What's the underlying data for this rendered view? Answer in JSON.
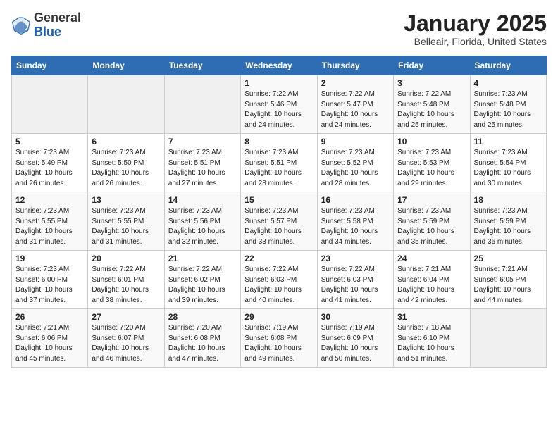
{
  "header": {
    "logo_general": "General",
    "logo_blue": "Blue",
    "title": "January 2025",
    "subtitle": "Belleair, Florida, United States"
  },
  "days_of_week": [
    "Sunday",
    "Monday",
    "Tuesday",
    "Wednesday",
    "Thursday",
    "Friday",
    "Saturday"
  ],
  "weeks": [
    [
      {
        "day": "",
        "info": ""
      },
      {
        "day": "",
        "info": ""
      },
      {
        "day": "",
        "info": ""
      },
      {
        "day": "1",
        "info": "Sunrise: 7:22 AM\nSunset: 5:46 PM\nDaylight: 10 hours\nand 24 minutes."
      },
      {
        "day": "2",
        "info": "Sunrise: 7:22 AM\nSunset: 5:47 PM\nDaylight: 10 hours\nand 24 minutes."
      },
      {
        "day": "3",
        "info": "Sunrise: 7:22 AM\nSunset: 5:48 PM\nDaylight: 10 hours\nand 25 minutes."
      },
      {
        "day": "4",
        "info": "Sunrise: 7:23 AM\nSunset: 5:48 PM\nDaylight: 10 hours\nand 25 minutes."
      }
    ],
    [
      {
        "day": "5",
        "info": "Sunrise: 7:23 AM\nSunset: 5:49 PM\nDaylight: 10 hours\nand 26 minutes."
      },
      {
        "day": "6",
        "info": "Sunrise: 7:23 AM\nSunset: 5:50 PM\nDaylight: 10 hours\nand 26 minutes."
      },
      {
        "day": "7",
        "info": "Sunrise: 7:23 AM\nSunset: 5:51 PM\nDaylight: 10 hours\nand 27 minutes."
      },
      {
        "day": "8",
        "info": "Sunrise: 7:23 AM\nSunset: 5:51 PM\nDaylight: 10 hours\nand 28 minutes."
      },
      {
        "day": "9",
        "info": "Sunrise: 7:23 AM\nSunset: 5:52 PM\nDaylight: 10 hours\nand 28 minutes."
      },
      {
        "day": "10",
        "info": "Sunrise: 7:23 AM\nSunset: 5:53 PM\nDaylight: 10 hours\nand 29 minutes."
      },
      {
        "day": "11",
        "info": "Sunrise: 7:23 AM\nSunset: 5:54 PM\nDaylight: 10 hours\nand 30 minutes."
      }
    ],
    [
      {
        "day": "12",
        "info": "Sunrise: 7:23 AM\nSunset: 5:55 PM\nDaylight: 10 hours\nand 31 minutes."
      },
      {
        "day": "13",
        "info": "Sunrise: 7:23 AM\nSunset: 5:55 PM\nDaylight: 10 hours\nand 31 minutes."
      },
      {
        "day": "14",
        "info": "Sunrise: 7:23 AM\nSunset: 5:56 PM\nDaylight: 10 hours\nand 32 minutes."
      },
      {
        "day": "15",
        "info": "Sunrise: 7:23 AM\nSunset: 5:57 PM\nDaylight: 10 hours\nand 33 minutes."
      },
      {
        "day": "16",
        "info": "Sunrise: 7:23 AM\nSunset: 5:58 PM\nDaylight: 10 hours\nand 34 minutes."
      },
      {
        "day": "17",
        "info": "Sunrise: 7:23 AM\nSunset: 5:59 PM\nDaylight: 10 hours\nand 35 minutes."
      },
      {
        "day": "18",
        "info": "Sunrise: 7:23 AM\nSunset: 5:59 PM\nDaylight: 10 hours\nand 36 minutes."
      }
    ],
    [
      {
        "day": "19",
        "info": "Sunrise: 7:23 AM\nSunset: 6:00 PM\nDaylight: 10 hours\nand 37 minutes."
      },
      {
        "day": "20",
        "info": "Sunrise: 7:22 AM\nSunset: 6:01 PM\nDaylight: 10 hours\nand 38 minutes."
      },
      {
        "day": "21",
        "info": "Sunrise: 7:22 AM\nSunset: 6:02 PM\nDaylight: 10 hours\nand 39 minutes."
      },
      {
        "day": "22",
        "info": "Sunrise: 7:22 AM\nSunset: 6:03 PM\nDaylight: 10 hours\nand 40 minutes."
      },
      {
        "day": "23",
        "info": "Sunrise: 7:22 AM\nSunset: 6:03 PM\nDaylight: 10 hours\nand 41 minutes."
      },
      {
        "day": "24",
        "info": "Sunrise: 7:21 AM\nSunset: 6:04 PM\nDaylight: 10 hours\nand 42 minutes."
      },
      {
        "day": "25",
        "info": "Sunrise: 7:21 AM\nSunset: 6:05 PM\nDaylight: 10 hours\nand 44 minutes."
      }
    ],
    [
      {
        "day": "26",
        "info": "Sunrise: 7:21 AM\nSunset: 6:06 PM\nDaylight: 10 hours\nand 45 minutes."
      },
      {
        "day": "27",
        "info": "Sunrise: 7:20 AM\nSunset: 6:07 PM\nDaylight: 10 hours\nand 46 minutes."
      },
      {
        "day": "28",
        "info": "Sunrise: 7:20 AM\nSunset: 6:08 PM\nDaylight: 10 hours\nand 47 minutes."
      },
      {
        "day": "29",
        "info": "Sunrise: 7:19 AM\nSunset: 6:08 PM\nDaylight: 10 hours\nand 49 minutes."
      },
      {
        "day": "30",
        "info": "Sunrise: 7:19 AM\nSunset: 6:09 PM\nDaylight: 10 hours\nand 50 minutes."
      },
      {
        "day": "31",
        "info": "Sunrise: 7:18 AM\nSunset: 6:10 PM\nDaylight: 10 hours\nand 51 minutes."
      },
      {
        "day": "",
        "info": ""
      }
    ]
  ]
}
